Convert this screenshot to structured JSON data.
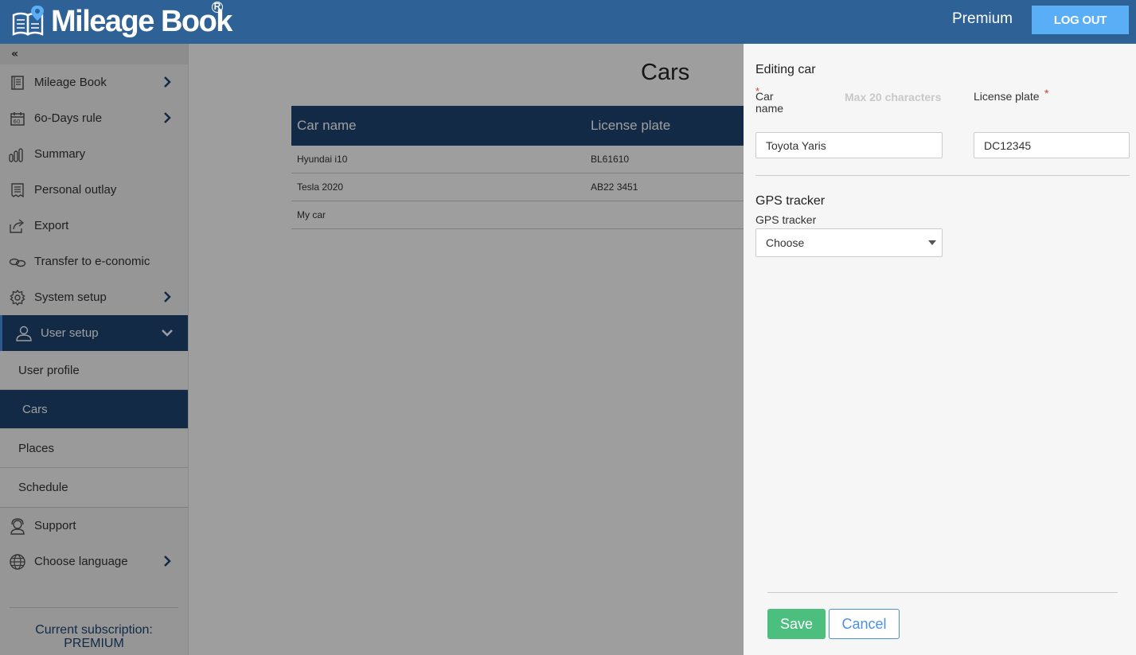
{
  "header": {
    "logo_text": "Mileage Book",
    "logo_reg": "R",
    "plan": "Premium",
    "logout_label": "LOG OUT"
  },
  "sidebar": {
    "collapse_label": "«",
    "items": [
      {
        "label": "Mileage Book",
        "icon": "book-icon",
        "chevron": true
      },
      {
        "label": "6o-Days rule",
        "icon": "calendar-60-icon",
        "chevron": true
      },
      {
        "label": "Summary",
        "icon": "bar-chart-icon",
        "chevron": false
      },
      {
        "label": "Personal outlay",
        "icon": "receipt-icon",
        "chevron": false
      },
      {
        "label": "Export",
        "icon": "export-icon",
        "chevron": false
      },
      {
        "label": "Transfer to e-conomic",
        "icon": "link-icon",
        "chevron": false
      },
      {
        "label": "System setup",
        "icon": "gear-icon",
        "chevron": true
      }
    ],
    "user_setup": {
      "label": "User setup",
      "children": [
        "User profile",
        "Cars",
        "Places",
        "Schedule"
      ],
      "active": "Cars"
    },
    "bottom_items": [
      {
        "label": "Support",
        "icon": "headset-icon",
        "chevron": false
      },
      {
        "label": "Choose language",
        "icon": "globe-icon",
        "chevron": true
      }
    ],
    "subscription_label": "Current subscription:",
    "subscription_value": "PREMIUM"
  },
  "main": {
    "title": "Cars",
    "columns": [
      "Car name",
      "License plate"
    ],
    "rows": [
      [
        "Hyundai i10",
        "BL61610"
      ],
      [
        "Tesla 2020",
        "AB22 3451"
      ],
      [
        "My car",
        ""
      ]
    ]
  },
  "panel": {
    "title": "Editing car",
    "car_name_label_1": "Car",
    "car_name_label_2": "name",
    "car_name_hint": "Max 20 characters",
    "car_name_value": "Toyota Yaris",
    "license_label": "License plate",
    "license_value": "DC12345",
    "required_mark": "*",
    "gps_section_title": "GPS tracker",
    "gps_label": "GPS tracker",
    "gps_selected": "Choose",
    "save_label": "Save",
    "cancel_label": "Cancel"
  },
  "colors": {
    "header": "#2e6196",
    "nav_active": "#1e4572",
    "logout": "#5aaef5",
    "save": "#4cbf7f",
    "cancel": "#4a90e2"
  }
}
